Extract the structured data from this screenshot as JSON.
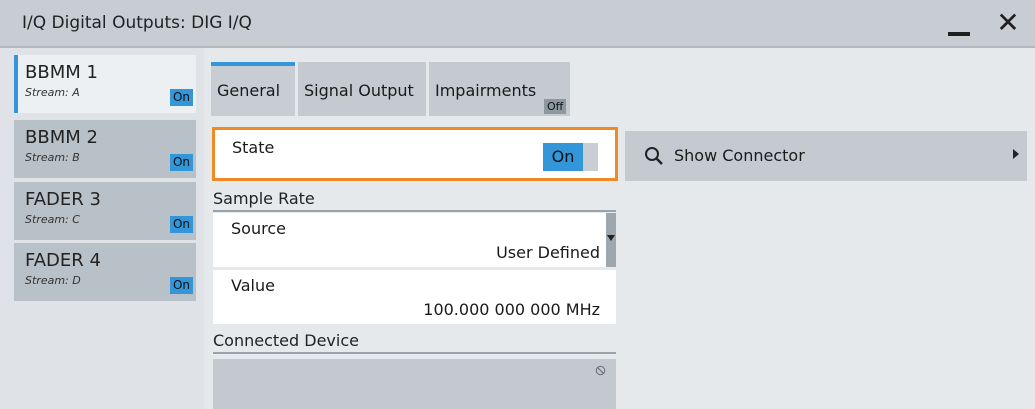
{
  "window": {
    "title": "I/Q Digital Outputs: DIG I/Q"
  },
  "streams": [
    {
      "name": "BBMM 1",
      "stream": "Stream: A",
      "state": "On"
    },
    {
      "name": "BBMM 2",
      "stream": "Stream: B",
      "state": "On"
    },
    {
      "name": "FADER 3",
      "stream": "Stream: C",
      "state": "On"
    },
    {
      "name": "FADER 4",
      "stream": "Stream: D",
      "state": "On"
    }
  ],
  "tabs": [
    {
      "label": "General"
    },
    {
      "label": "Signal Output"
    },
    {
      "label": "Impairments",
      "badge": "Off"
    }
  ],
  "general": {
    "state_label": "State",
    "state_value": "On",
    "show_connector": "Show Connector",
    "sample_rate_section": "Sample Rate",
    "source_label": "Source",
    "source_value": "User Defined",
    "value_label": "Value",
    "value_value": "100.000 000 000 MHz",
    "connected_device_section": "Connected Device"
  },
  "colors": {
    "accent": "#3296d8",
    "focus": "#f08a24"
  }
}
